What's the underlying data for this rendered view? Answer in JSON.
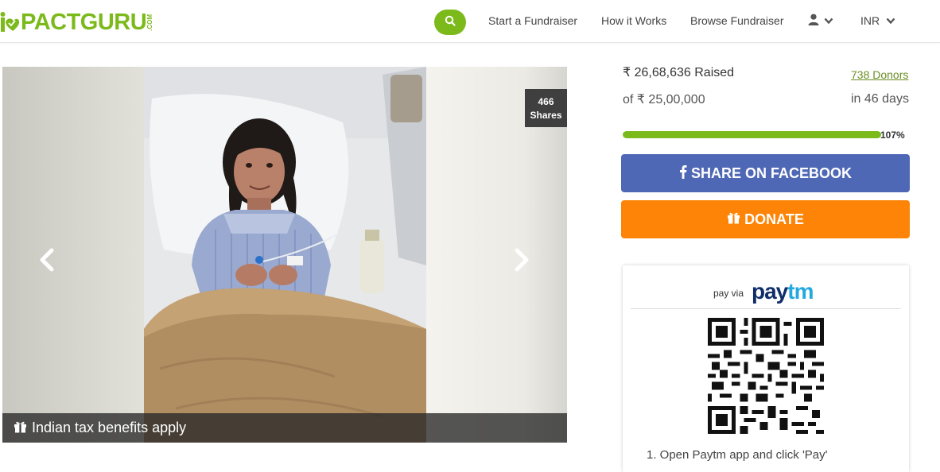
{
  "brand": {
    "name": "PACTGURU",
    "suffix": ".COM",
    "color": "#7cba1c"
  },
  "nav": {
    "links": [
      "Start a Fundraiser",
      "How it Works",
      "Browse Fundraiser"
    ],
    "currency": "INR"
  },
  "gallery": {
    "shares_count": "466",
    "shares_label": "Shares",
    "tax_label": "Indian tax benefits apply"
  },
  "campaign": {
    "raised": "₹ 26,68,636 Raised",
    "goal": "of ₹ 25,00,000",
    "donors": "738 Donors",
    "days": "in 46 days",
    "percent_text": "107%",
    "progress_fraction": 1.0
  },
  "actions": {
    "facebook_label": "SHARE ON FACEBOOK",
    "donate_label": "DONATE",
    "facebook_color": "#4f68b5",
    "donate_color": "#fd8407"
  },
  "paytm": {
    "pay_via": "pay via",
    "logo_pay": "pay",
    "logo_tm": "tm",
    "step1": "1. Open Paytm app and click 'Pay'"
  }
}
